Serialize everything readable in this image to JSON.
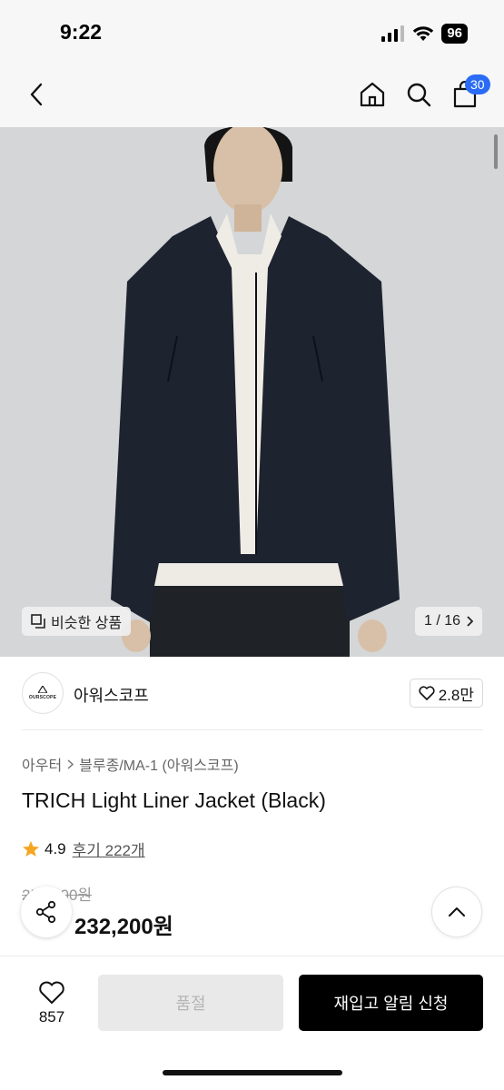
{
  "status_bar": {
    "time": "9:22",
    "battery": "96"
  },
  "nav": {
    "cart_count": "30"
  },
  "gallery": {
    "similar_label": "비슷한 상품",
    "counter": "1 / 16"
  },
  "brand": {
    "logo_text": "OURSCOPE",
    "name": "아워스코프",
    "like_count": "2.8만"
  },
  "breadcrumb": {
    "level1": "아우터",
    "level2": "블루종/MA-1 (아워스코프)"
  },
  "product": {
    "title": "TRICH Light Liner Jacket (Black)",
    "rating": "4.9",
    "review_label": "후기 222개",
    "original_price": "253,000원",
    "sale_price": "232,200원"
  },
  "bottom_bar": {
    "wish_count": "857",
    "soldout_label": "품절",
    "restock_label": "재입고 알림 신청"
  },
  "colors": {
    "accent": "#2b6cf6",
    "star": "#f5a623",
    "primary_button": "#000000"
  },
  "icons": [
    "back-icon",
    "home-icon",
    "search-icon",
    "cart-icon",
    "similar-icon",
    "chevron-right-icon",
    "heart-icon",
    "star-icon",
    "share-icon",
    "chevron-up-icon"
  ]
}
